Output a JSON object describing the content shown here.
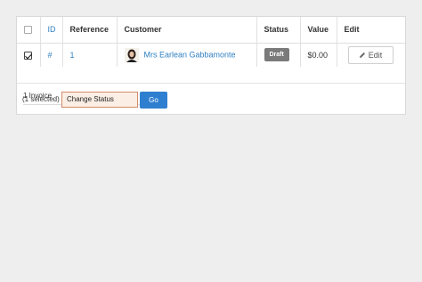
{
  "table": {
    "headers": {
      "id": "ID",
      "reference": "Reference",
      "customer": "Customer",
      "status": "Status",
      "value": "Value",
      "edit": "Edit"
    },
    "rows": [
      {
        "checked": true,
        "id": "#",
        "reference": "1",
        "customer": "Mrs Earlean Gabbamonte",
        "status": "Draft",
        "value": "$0.00",
        "edit_label": "Edit"
      }
    ]
  },
  "footer": {
    "count": "1 Invoice",
    "selected": "(1 selected)",
    "action_value": "Change Status",
    "go_label": "Go"
  },
  "colors": {
    "link": "#2f80c2",
    "go_button": "#2f7fd0",
    "draft_badge": "#7a7a7a",
    "select_border": "#d58a6a"
  }
}
